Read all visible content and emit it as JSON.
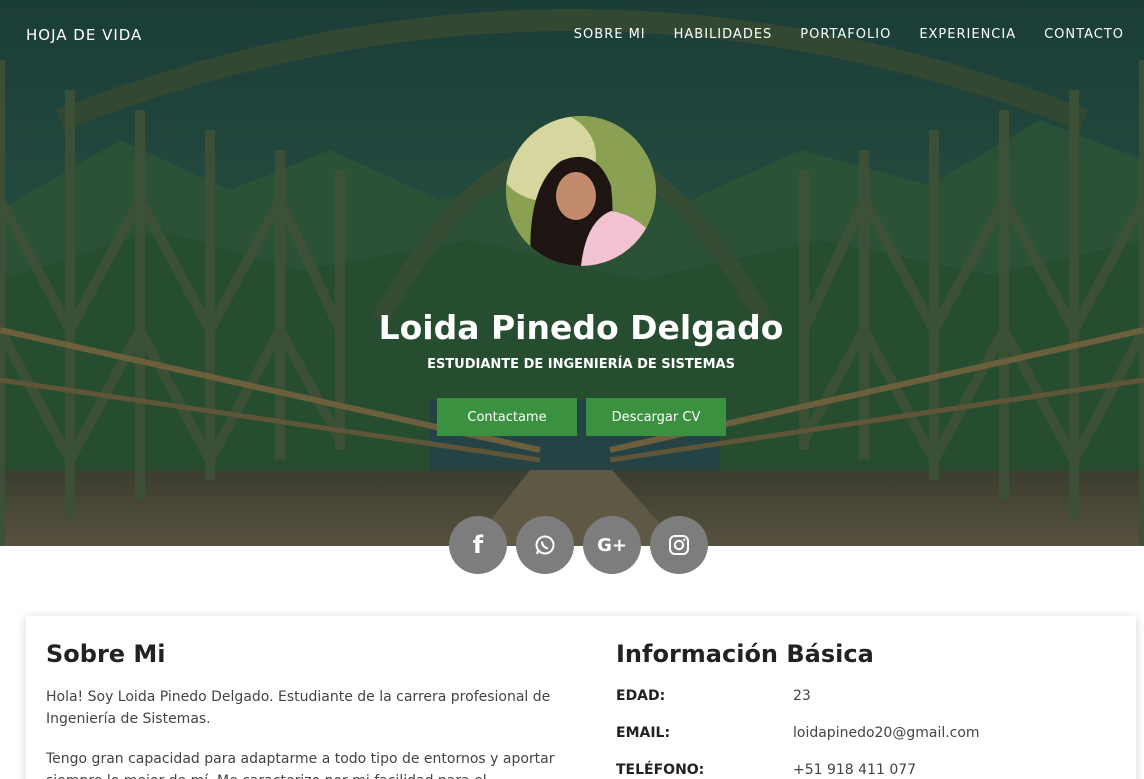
{
  "nav": {
    "brand": "HOJA DE VIDA",
    "links": [
      "SOBRE MI",
      "HABILIDADES",
      "PORTAFOLIO",
      "EXPERIENCIA",
      "CONTACTO"
    ]
  },
  "hero": {
    "name": "Loida Pinedo Delgado",
    "subtitle": "ESTUDIANTE DE INGENIERÍA DE SISTEMAS",
    "buttons": {
      "contact": "Contactame",
      "cv": "Descargar CV"
    }
  },
  "socials": [
    {
      "icon": "facebook-icon",
      "glyph": "f"
    },
    {
      "icon": "whatsapp-icon",
      "glyph": ""
    },
    {
      "icon": "google-plus-icon",
      "glyph": "G+"
    },
    {
      "icon": "instagram-icon",
      "glyph": ""
    }
  ],
  "about": {
    "title": "Sobre Mi",
    "paragraph1": "Hola! Soy Loida Pinedo Delgado. Estudiante de la carrera profesional de Ingeniería de Sistemas.",
    "paragraph2": "Tengo gran capacidad para adaptarme a todo tipo de entornos y aportar siempre lo mejor de mí. Me caracterizo por mi facilidad para el"
  },
  "info": {
    "title": "Información Básica",
    "rows": [
      {
        "label": "EDAD:",
        "value": "23"
      },
      {
        "label": "EMAIL:",
        "value": "loidapinedo20@gmail.com"
      },
      {
        "label": "TELÉFONO:",
        "value": "+51 918 411 077"
      }
    ]
  },
  "colors": {
    "accent_green": "#3a9140",
    "social_gray": "#7d7d7d",
    "hero_overlay": "#21433d"
  }
}
